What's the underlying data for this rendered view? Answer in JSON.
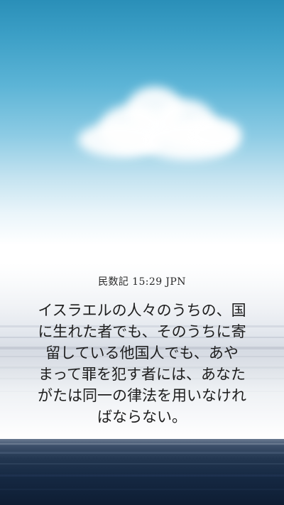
{
  "verse": {
    "reference": "民数記 15:29 JPN",
    "lines": [
      "イスラエルの人々のうちの、国",
      "に生れた者でも、そのうちに寄",
      "留している他国人でも、あや",
      "まって罪を犯す者には、あなた",
      "がたは同一の律法を用いなけれ",
      "ばならない。"
    ]
  },
  "colors": {
    "sky_top": "#2a8fb8",
    "sky_horizon": "#ffffff",
    "sea": "#152842",
    "text": "#1e1e1e"
  }
}
